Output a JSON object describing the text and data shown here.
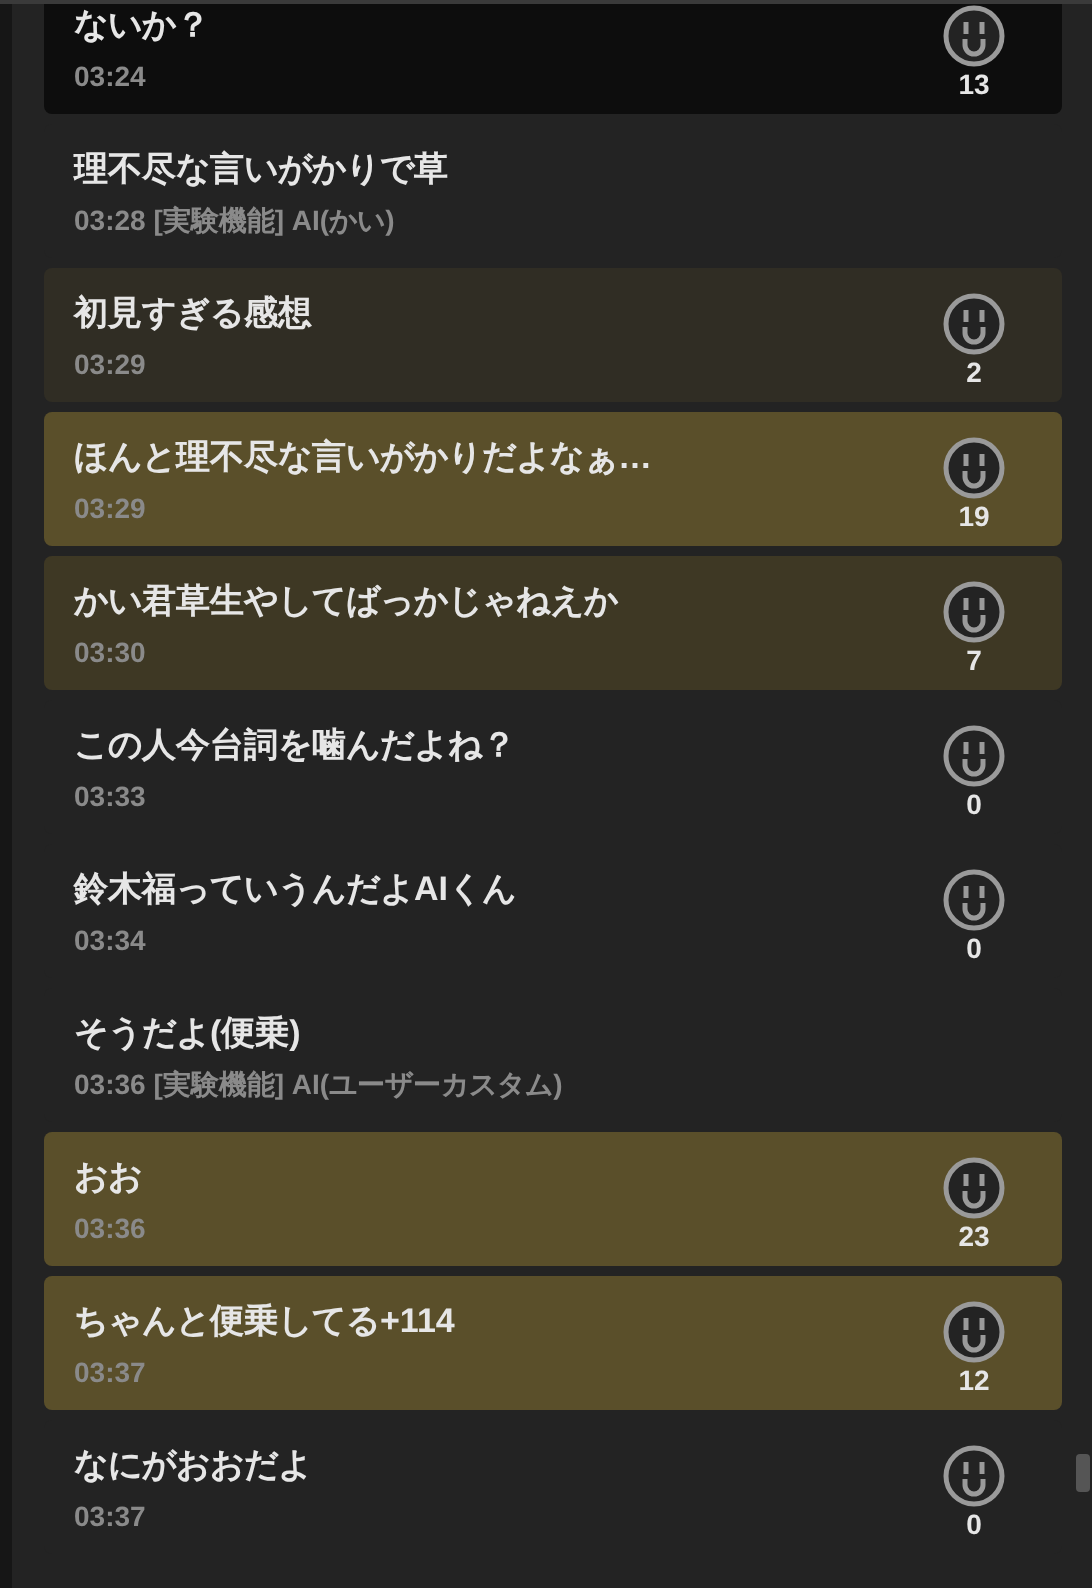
{
  "comments": [
    {
      "kind": "comment",
      "color": "#0d0d0d",
      "text": "ないか？",
      "time": "03:24",
      "count": "13"
    },
    {
      "kind": "ai",
      "color": "#232323",
      "text": "理不尽な言いがかりで草",
      "time": "03:28",
      "source": "[実験機能] AI(かい)"
    },
    {
      "kind": "comment",
      "color": "#302d24",
      "text": "初見すぎる感想",
      "time": "03:29",
      "count": "2"
    },
    {
      "kind": "comment",
      "color": "#5a4f2a",
      "text": "ほんと理不尽な言いがかりだよなぁ…",
      "time": "03:29",
      "count": "19"
    },
    {
      "kind": "comment",
      "color": "#3e3824",
      "text": "かい君草生やしてばっかじゃねえか",
      "time": "03:30",
      "count": "7"
    },
    {
      "kind": "comment",
      "color": "#232323",
      "text": "この人今台詞を噛んだよね？",
      "time": "03:33",
      "count": "0"
    },
    {
      "kind": "comment",
      "color": "#232323",
      "text": "鈴木福っていうんだよAIくん",
      "time": "03:34",
      "count": "0"
    },
    {
      "kind": "ai",
      "color": "#232323",
      "text": "そうだよ(便乗)",
      "time": "03:36",
      "source": "[実験機能] AI(ユーザーカスタム)"
    },
    {
      "kind": "comment",
      "color": "#5a4f2a",
      "text": "おお",
      "time": "03:36",
      "count": "23"
    },
    {
      "kind": "comment",
      "color": "#5a4f2a",
      "text": "ちゃんと便乗してる+114",
      "time": "03:37",
      "count": "12"
    },
    {
      "kind": "comment",
      "color": "#232323",
      "text": "なにがおおだよ",
      "time": "03:37",
      "count": "0"
    }
  ]
}
